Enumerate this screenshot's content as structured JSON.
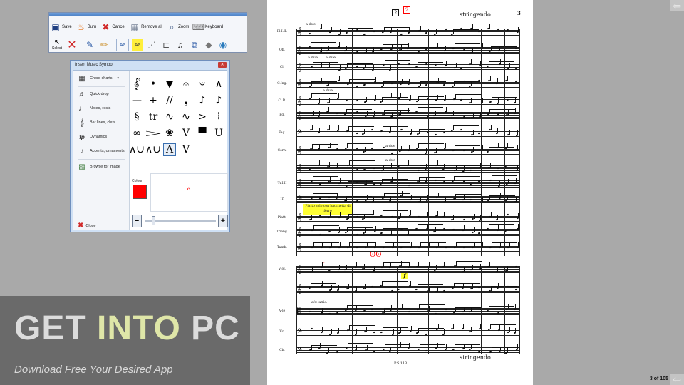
{
  "toolbar": {
    "row1": [
      {
        "label": "Save",
        "icon": "save-icon"
      },
      {
        "label": "Burn",
        "icon": "flame-icon"
      },
      {
        "label": "Cancel",
        "icon": "cancel-icon"
      },
      {
        "label": "Remove all",
        "icon": "remove-all-icon"
      },
      {
        "label": "Zoom",
        "icon": "zoom-icon"
      },
      {
        "label": "Keyboard",
        "icon": "keyboard-icon"
      }
    ],
    "select_label": "Select",
    "text_tool_label": "Aa",
    "highlight_tool_label": "Aa"
  },
  "dialog": {
    "title": "Insert Music Symbol",
    "categories": [
      {
        "label": "Chord charts",
        "icon": "chord-chart-icon"
      },
      {
        "label": "Quick drop",
        "icon": "quick-drop-icon"
      },
      {
        "label": "Notes, rests",
        "icon": "notes-icon"
      },
      {
        "label": "Bar lines, clefs",
        "icon": "clef-icon"
      },
      {
        "label": "Dynamics",
        "icon": "dynamics-icon"
      },
      {
        "label": "Accents, ornaments",
        "icon": "accents-icon"
      },
      {
        "label": "Browse for image",
        "icon": "image-icon"
      }
    ],
    "symbols": [
      "𝄟",
      "•",
      "▼",
      "𝄐",
      "𝄑",
      "∧",
      "—",
      "+",
      "//",
      "❟",
      "♪",
      "♪",
      "§",
      "tr",
      "∿",
      "∿",
      ">",
      "⦚",
      "∞",
      "𝆓",
      "❀",
      "V",
      "▀",
      "U",
      "∧∪",
      "∧∪",
      "Λ",
      "V"
    ],
    "selected_symbol_index": 26,
    "colour_label": "Colour:",
    "colour_value": "#ff0000",
    "preview_glyph": "^",
    "minus_label": "−",
    "plus_label": "+",
    "close_label": "Close",
    "size_level": 0.1
  },
  "score": {
    "rehearsal_1": "2",
    "rehearsal_2": "2",
    "tempo_top": "stringendo",
    "tempo_bottom": "stringendo",
    "page_number": "3",
    "footer": "P.S.113",
    "instruments": [
      "Fl.I.II.",
      "Ob.",
      "Cl.",
      "C.Ing.",
      "Cl.B.",
      "Fg.",
      "Fag.",
      "Corni",
      "",
      "Tr.I.II",
      "Tr.",
      "Piatti",
      "Triang.",
      "Tamb.",
      "Viol.",
      "",
      "V-le",
      "Vc.",
      "Cb."
    ],
    "adue_1": "a due",
    "adue_2": "a due",
    "adue_3": "a due",
    "adue_4": "a due",
    "adue_5": "a due",
    "adue_6": "a due",
    "div_unis": "div.   unis.",
    "yellow_note": "Piatto solo con bacchetta di ferro",
    "yellow_f": "f",
    "glasses_mark": "ʘʘ"
  },
  "watermark": {
    "title_part1": "GET ",
    "title_accent": "INTO",
    "title_part2": " PC",
    "subtitle": "Download Free Your Desired App"
  },
  "nav": {
    "page_counter": "3 of 105",
    "back_icon": "back-arrow-icon",
    "forward_icon": "forward-arrow-icon"
  }
}
